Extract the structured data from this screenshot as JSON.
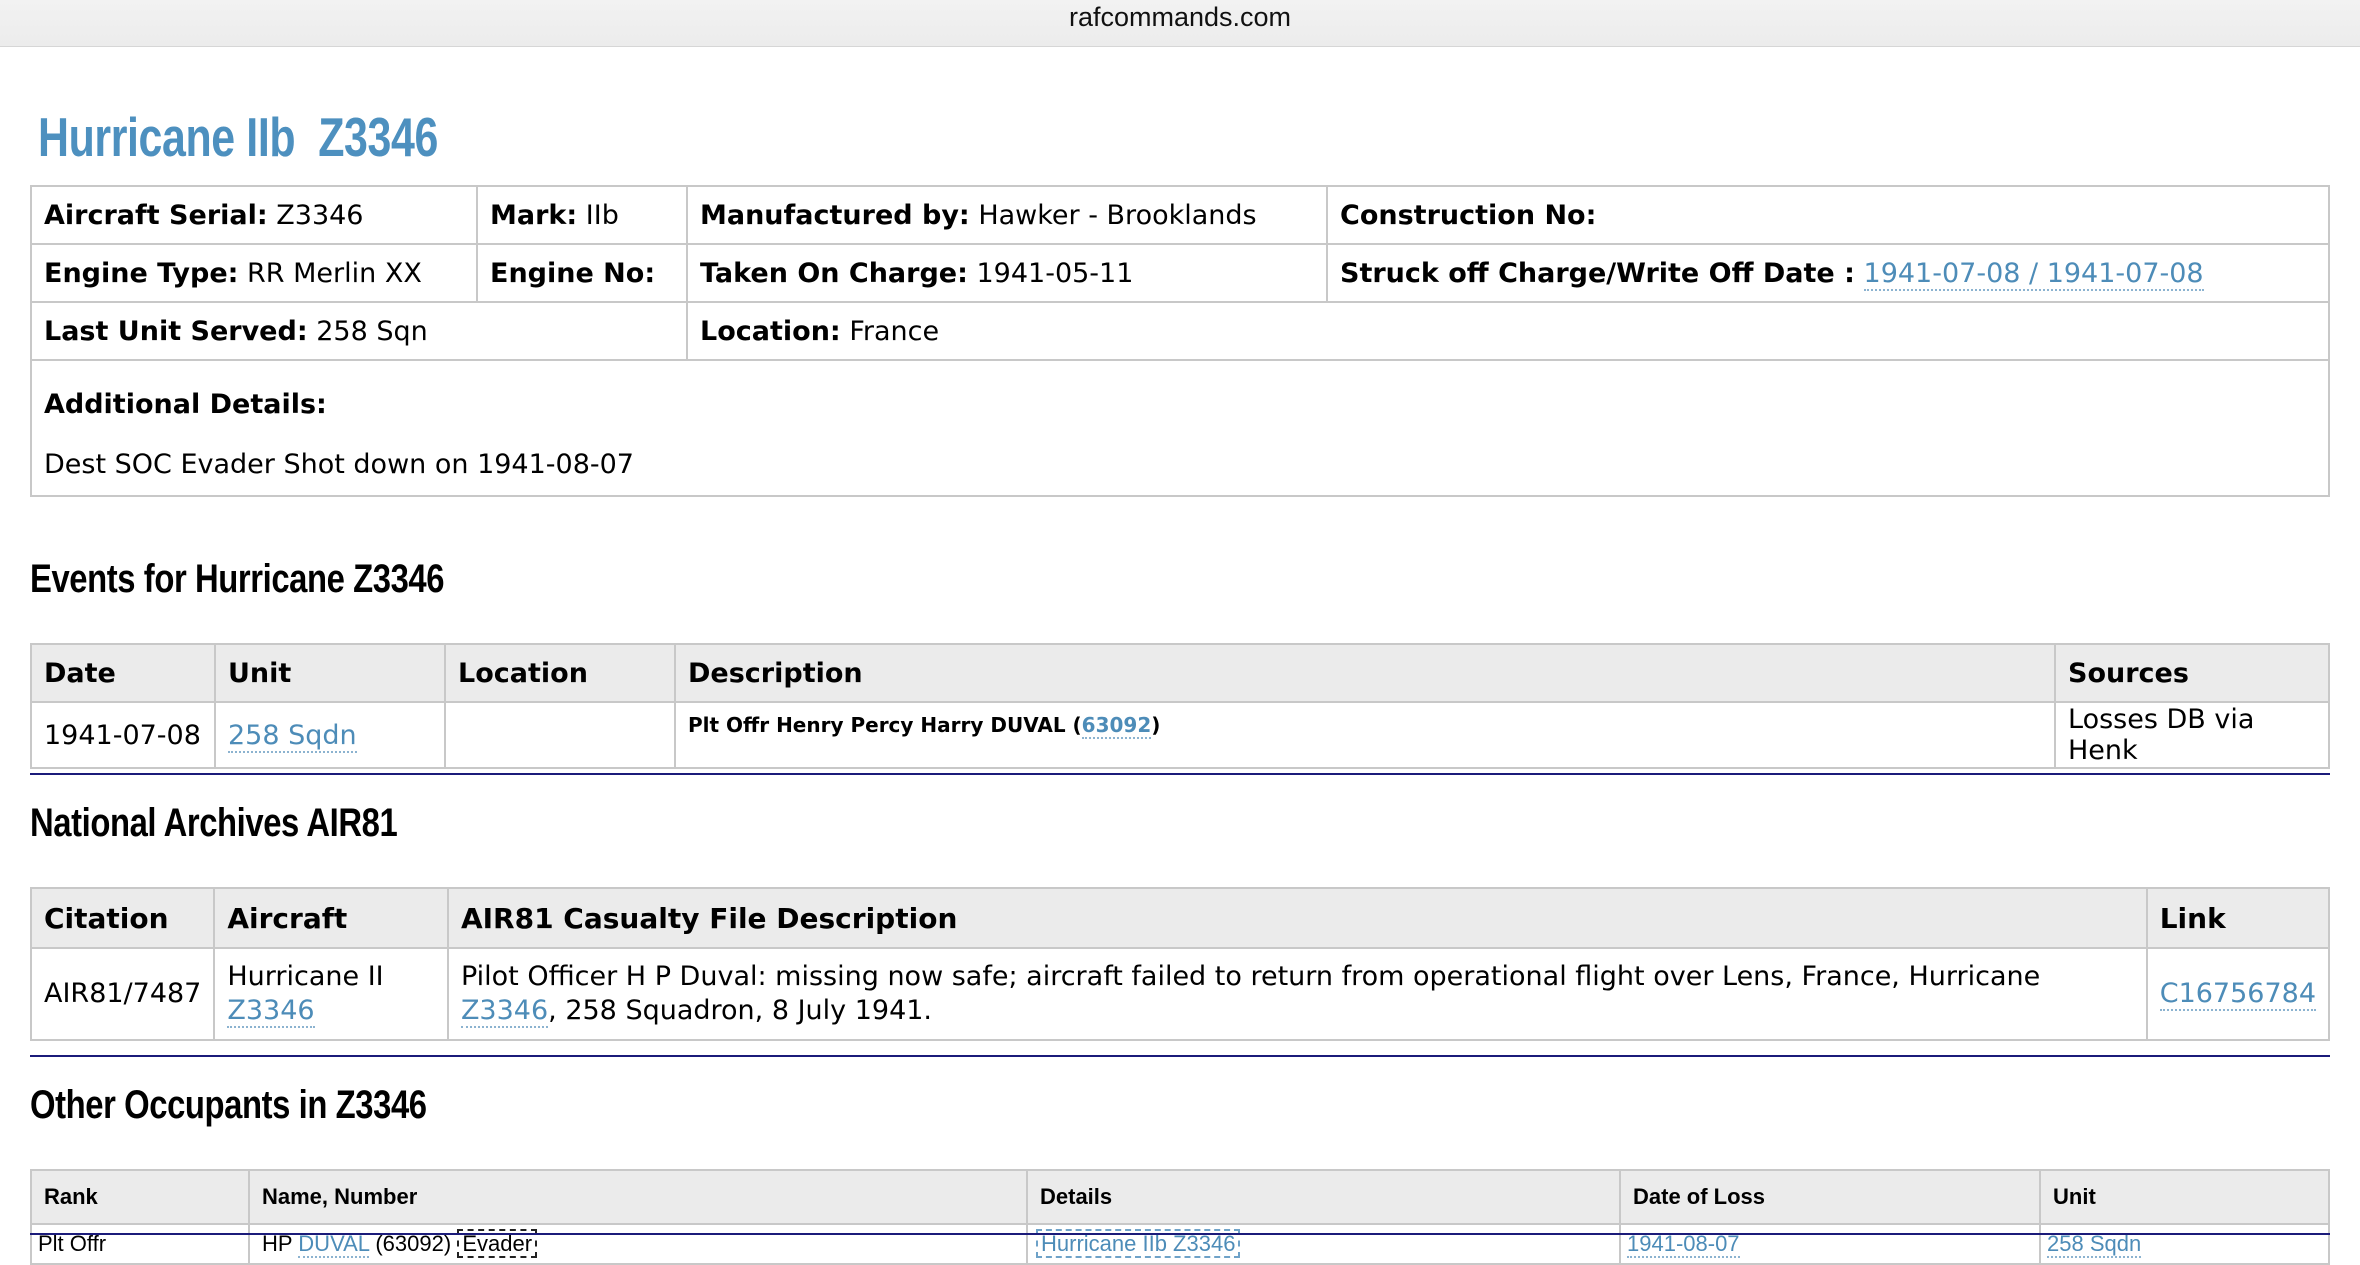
{
  "browser": {
    "domain": "rafcommands.com"
  },
  "page_title": "Hurricane IIb  Z3346",
  "aircraft": {
    "serial_label": "Aircraft Serial:",
    "serial": "Z3346",
    "mark_label": "Mark:",
    "mark": "IIb",
    "manufacturer_label": "Manufactured by:",
    "manufacturer": "Hawker - Brooklands",
    "construction_label": "Construction No:",
    "construction": "",
    "engine_type_label": "Engine Type:",
    "engine_type": "RR Merlin XX",
    "engine_no_label": "Engine No:",
    "engine_no": "",
    "taken_label": "Taken On Charge:",
    "taken": "1941-05-11",
    "struck_label": "Struck off Charge/Write Off Date :",
    "struck": "1941-07-08 / 1941-07-08",
    "last_unit_label": "Last Unit Served:",
    "last_unit": "258 Sqn",
    "location_label": "Location:",
    "location": "France",
    "details_label": "Additional Details:",
    "details": "Dest SOC Evader Shot down on 1941-08-07"
  },
  "events": {
    "title": "Events for Hurricane Z3346",
    "headers": [
      "Date",
      "Unit",
      "Location",
      "Description",
      "Sources"
    ],
    "row": {
      "date": "1941-07-08",
      "unit": "258 Sqdn",
      "location": "",
      "desc_prefix": "Plt Offr Henry Percy Harry DUVAL (",
      "desc_link": "63092",
      "desc_suffix": ")",
      "sources": "Losses DB via Henk"
    }
  },
  "air81": {
    "title": "National Archives AIR81",
    "headers": [
      "Citation",
      "Aircraft",
      "AIR81 Casualty File Description",
      "Link"
    ],
    "row": {
      "citation": "AIR81/7487",
      "aircraft_text": "Hurricane II",
      "aircraft_link": "Z3346",
      "desc_prefix": "Pilot Officer H P Duval: missing now safe; aircraft failed to return from operational flight over Lens, France, Hurricane ",
      "desc_link": "Z3346",
      "desc_suffix": ", 258 Squadron, 8 July 1941.",
      "link": "C16756784"
    }
  },
  "occupants": {
    "title": "Other Occupants in Z3346",
    "headers": [
      "Rank",
      "Name, Number",
      "Details",
      "Date of Loss",
      "Unit"
    ],
    "row": {
      "rank": "Plt Offr",
      "initials": "HP",
      "name_link": "DUVAL",
      "number": "(63092)",
      "badge": "Evader",
      "details": "Hurricane IIb Z3346",
      "date_of_loss": "1941-08-07",
      "unit": "258 Sqdn"
    }
  },
  "colors": {
    "link": "#4d8cb8",
    "title": "#4d90bf",
    "rule": "#1b1b7a",
    "header_bg": "#ebebeb"
  }
}
